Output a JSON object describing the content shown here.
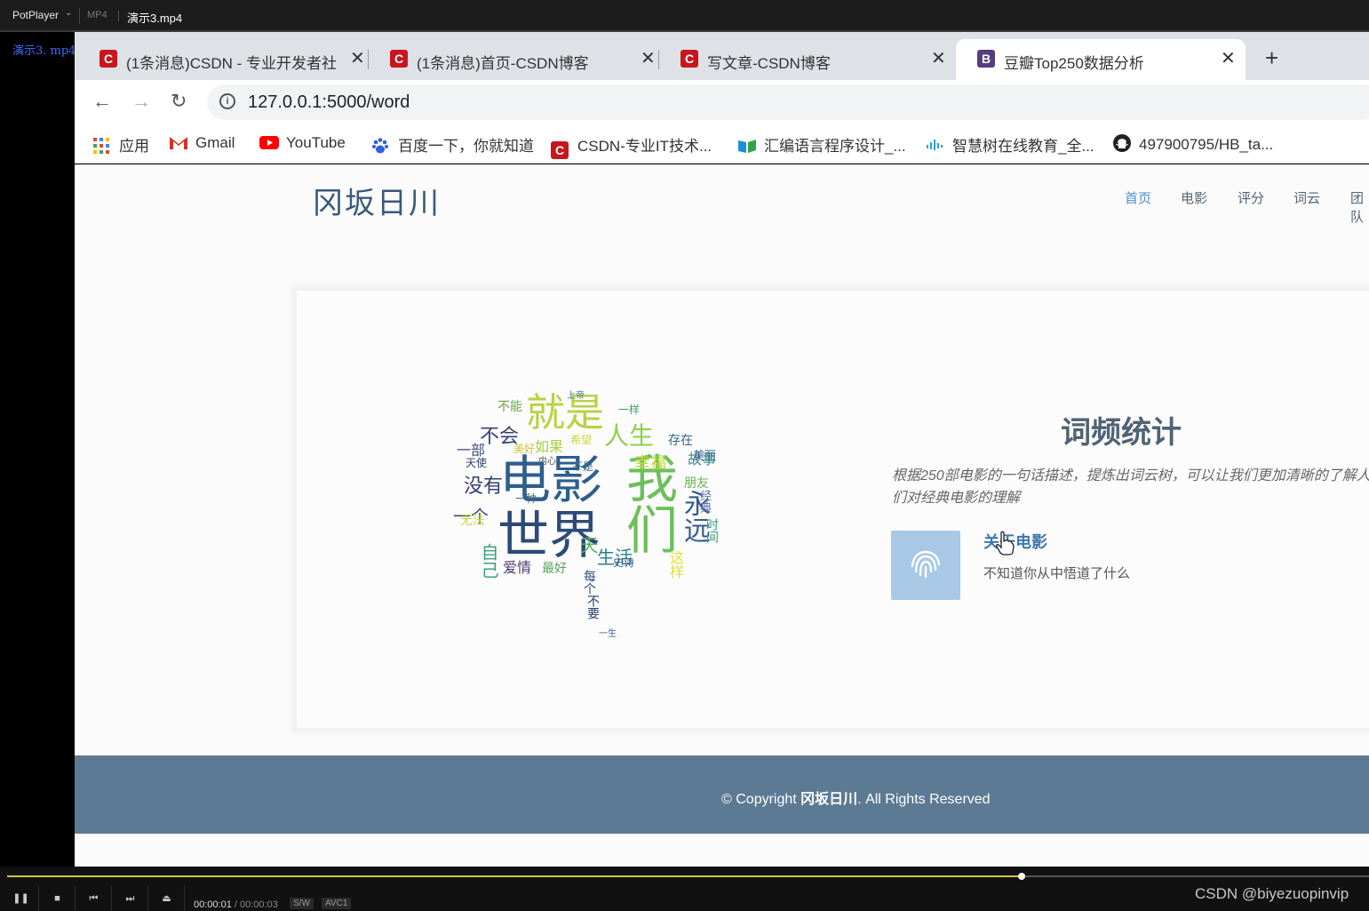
{
  "player": {
    "brand": "PotPlayer",
    "format": "MP4",
    "filename": "演示3.mp4",
    "overlay_filename": "演示3. mp4",
    "time_current": "00:00:01",
    "time_separator": "/",
    "time_total": "00:00:03",
    "badge_sw": "S/W",
    "badge_codec": "AVC1",
    "progress_fraction": 0.745,
    "watermark": "CSDN @biyezuopinvip"
  },
  "browser": {
    "tabs": [
      {
        "title": "(1条消息)CSDN - 专业开发者社区",
        "favicon": "C"
      },
      {
        "title": "(1条消息)首页-CSDN博客",
        "favicon": "C"
      },
      {
        "title": "写文章-CSDN博客",
        "favicon": "C"
      },
      {
        "title": "豆瓣Top250数据分析",
        "favicon": "B"
      }
    ],
    "close_glyph": "✕",
    "new_tab_glyph": "+",
    "url": "127.0.0.1:5000/word",
    "bookmarks": [
      {
        "label": "应用"
      },
      {
        "label": "Gmail"
      },
      {
        "label": "YouTube"
      },
      {
        "label": "百度一下，你就知道"
      },
      {
        "label": "CSDN-专业IT技术..."
      },
      {
        "label": "汇编语言程序设计_..."
      },
      {
        "label": "智慧树在线教育_全..."
      },
      {
        "label": "497900795/HB_ta..."
      }
    ]
  },
  "site": {
    "logo": "冈坂日川",
    "nav": [
      "首页",
      "电影",
      "评分",
      "词云",
      "团队"
    ],
    "heading": "词频统计",
    "description": "根据250部电影的一句话描述，提炼出词云树，可以让我们更加清晰的了解人们对经典电影的理解",
    "feature_title": "关于电影",
    "feature_subtitle": "不知道你从中悟道了什么",
    "footer_prefix": "© Copyright ",
    "footer_brand": "冈坂日川",
    "footer_suffix": ". All Rights Reserved",
    "wordcloud_words": [
      "电影",
      "世界",
      "我们",
      "就是",
      "人生",
      "永远",
      "没有",
      "不会",
      "生活",
      "一个",
      "自己",
      "爱情",
      "故事",
      "幸福",
      "如果",
      "这样",
      "存在",
      "不能",
      "一部",
      "最好",
      "美丽",
      "无法",
      "天使",
      "时间",
      "内心",
      "每个",
      "不要",
      "一生",
      "美好",
      "一种",
      "希望",
      "上帝",
      "朋友",
      "经典",
      "史诗",
      "一样",
      "天",
      "不是"
    ]
  },
  "colors": {
    "accent": "#4a8fc9",
    "footer_bg": "#5c7a93",
    "heading": "#4f6375",
    "feature_icon_bg": "#a8c8e6",
    "csdn_red": "#c8161d",
    "bootstrap_purple": "#563d7c",
    "progress": "#d9c038"
  }
}
